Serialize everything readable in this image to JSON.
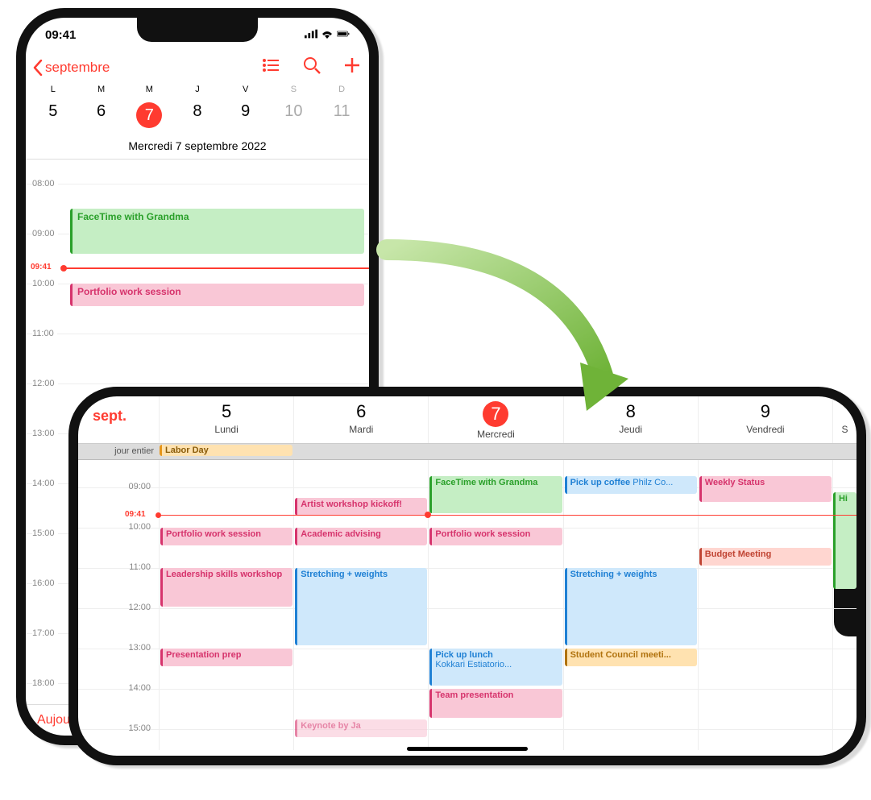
{
  "status": {
    "time": "09:41"
  },
  "portrait": {
    "back_label": "septembre",
    "weekdays": [
      "L",
      "M",
      "M",
      "J",
      "V",
      "S",
      "D"
    ],
    "dates": [
      "5",
      "6",
      "7",
      "8",
      "9",
      "10",
      "11"
    ],
    "date_full": "Mercredi 7 septembre 2022",
    "now_label": "09:41",
    "hours": [
      "08:00",
      "09:00",
      "10:00",
      "11:00",
      "12:00",
      "13:00",
      "14:00",
      "15:00",
      "16:00",
      "17:00",
      "18:00"
    ],
    "events": {
      "e1": "FaceTime with Grandma",
      "e2": "Portfolio work session"
    },
    "today_button": "Aujou"
  },
  "landscape": {
    "month": "sept.",
    "days": [
      {
        "num": "5",
        "name": "Lundi"
      },
      {
        "num": "6",
        "name": "Mardi"
      },
      {
        "num": "7",
        "name": "Mercredi"
      },
      {
        "num": "8",
        "name": "Jeudi"
      },
      {
        "num": "9",
        "name": "Vendredi"
      }
    ],
    "partial_day": "S",
    "allday_label": "jour entier",
    "allday_event": "Labor Day",
    "now_label": "09:41",
    "hours": [
      "09:00",
      "10:00",
      "11:00",
      "12:00",
      "13:00",
      "14:00",
      "15:00"
    ],
    "events": {
      "mon": {
        "portfolio": "Portfolio work session",
        "leadership": "Leadership skills workshop",
        "prep": "Presentation prep"
      },
      "tue": {
        "artist": "Artist workshop kickoff!",
        "advising": "Academic advising",
        "stretch": "Stretching + weights",
        "keynote": "Keynote by Ja"
      },
      "wed": {
        "facetime": "FaceTime with Grandma",
        "portfolio": "Portfolio work session",
        "lunch": "Pick up lunch",
        "lunch_loc": "Kokkari Estiatorio...",
        "team": "Team presentation"
      },
      "thu": {
        "coffee": "Pick up coffee",
        "coffee_loc": "Philz Co...",
        "stretch": "Stretching + weights",
        "council": "Student Council meeti..."
      },
      "fri": {
        "weekly": "Weekly Status",
        "budget": "Budget Meeting",
        "hi": "Hi"
      }
    }
  }
}
